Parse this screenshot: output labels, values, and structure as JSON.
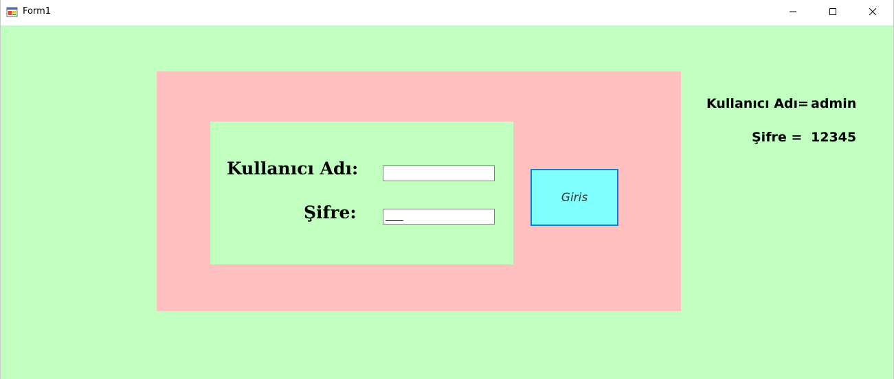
{
  "window": {
    "title": "Form1",
    "minimize_icon": "minimize-icon",
    "maximize_icon": "maximize-icon",
    "close_icon": "close-icon"
  },
  "login": {
    "username_label": "Kullanıcı Adı:",
    "password_label": "Şifre:",
    "username_value": "",
    "password_value": "____",
    "button_label": "Giris"
  },
  "hint": {
    "username_key": "Kullanıcı Adı=",
    "username_value": "admin",
    "password_key": "Şifre =",
    "password_value": "12345"
  },
  "colors": {
    "form_background": "#c0ffc0",
    "outer_panel": "#ffc0c0",
    "inner_panel": "#c0ffc0",
    "button_background": "#80ffff",
    "button_border": "#1f78d1"
  }
}
